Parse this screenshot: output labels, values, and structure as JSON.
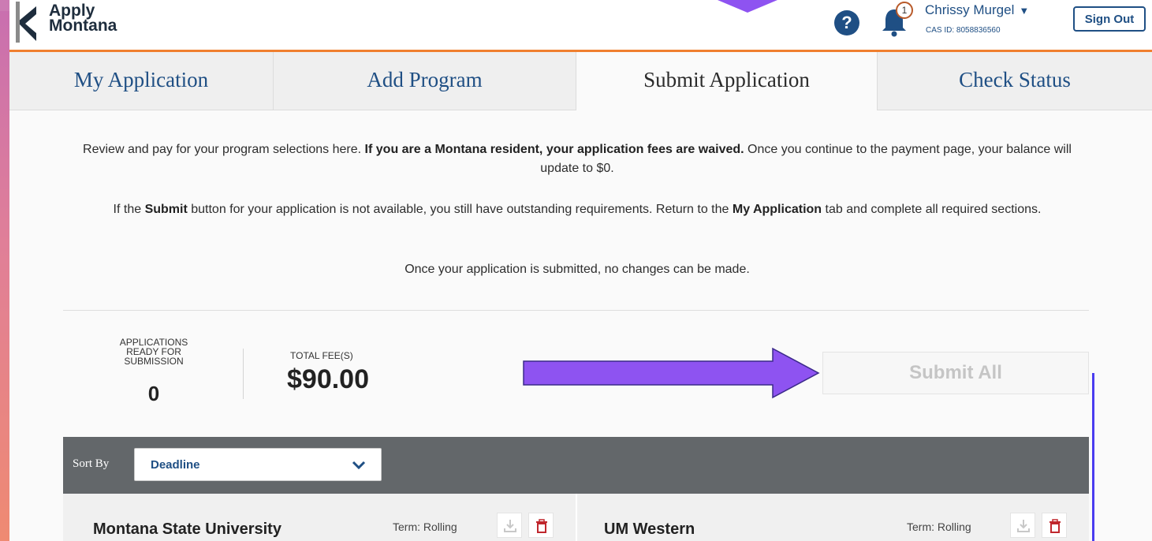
{
  "header": {
    "logo_line1": "Apply",
    "logo_line2": "Montana",
    "notification_count": "1",
    "user_name": "Chrissy Murgel",
    "cas_id": "CAS ID: 8058836560",
    "sign_out": "Sign Out",
    "help_icon": "?"
  },
  "tabs": [
    {
      "label": "My Application",
      "active": false
    },
    {
      "label": "Add Program",
      "active": false
    },
    {
      "label": "Submit Application",
      "active": true
    },
    {
      "label": "Check Status",
      "active": false
    }
  ],
  "intro": {
    "p1_a": "Review and pay for your program selections here. ",
    "p1_b": "If you are a Montana resident, your application fees are waived.",
    "p1_c": " Once you continue to the payment page, your balance will update to $0.",
    "p2_a": "If the ",
    "p2_b": "Submit",
    "p2_c": " button for your application is not available, you still have outstanding requirements. Return to the ",
    "p2_d": "My Application",
    "p2_e": " tab and complete all required sections.",
    "p3": "Once your application is submitted, no changes can be made."
  },
  "summary": {
    "ready_label": "APPLICATIONS READY FOR SUBMISSION",
    "ready_count": "0",
    "fee_label": "TOTAL FEE(S)",
    "fee_value": "$90.00",
    "submit_all": "Submit All"
  },
  "sort": {
    "label": "Sort By",
    "selected": "Deadline"
  },
  "programs": [
    {
      "name": "Montana State University",
      "term": "Term: Rolling"
    },
    {
      "name": "UM Western",
      "term": "Term: Rolling"
    }
  ],
  "colors": {
    "accent_orange": "#f07f2f",
    "brand_blue": "#1f4f84",
    "annotation_purple": "#8e53f1",
    "delete_red": "#c0272d"
  }
}
